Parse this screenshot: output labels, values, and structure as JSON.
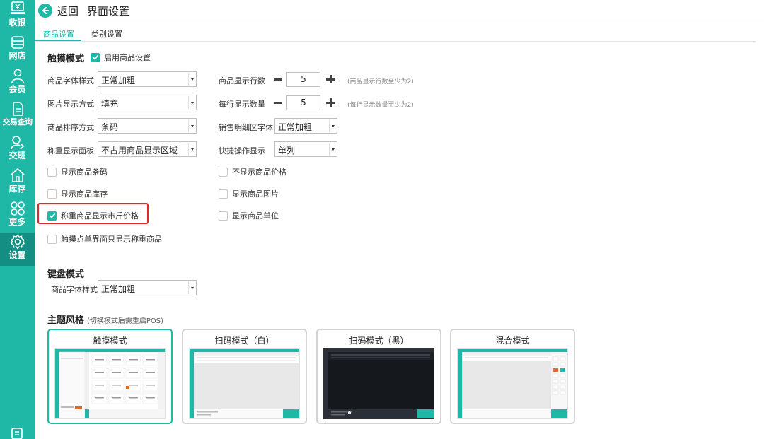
{
  "sidebar": {
    "items": [
      {
        "label": "收银",
        "icon": "cashier-icon",
        "active": false
      },
      {
        "label": "网店",
        "icon": "store-icon",
        "active": false
      },
      {
        "label": "会员",
        "icon": "member-icon",
        "active": false
      },
      {
        "label": "交易查询",
        "icon": "document-icon",
        "active": false
      },
      {
        "label": "交班",
        "icon": "handover-icon",
        "active": false
      },
      {
        "label": "库存",
        "icon": "home-icon",
        "active": false
      },
      {
        "label": "更多",
        "icon": "more-grid-icon",
        "active": false
      },
      {
        "label": "设置",
        "icon": "gear-icon",
        "active": true
      }
    ]
  },
  "header": {
    "back_label": "返回",
    "title": "界面设置"
  },
  "tabs": [
    {
      "label": "商品设置",
      "active": true
    },
    {
      "label": "类别设置",
      "active": false
    }
  ],
  "touch": {
    "section_title": "触摸模式",
    "enable_label": "启用商品设置",
    "enable_checked": true,
    "font_style_label": "商品字体样式",
    "font_style_value": "正常加粗",
    "image_mode_label": "图片显示方式",
    "image_mode_value": "填充",
    "sort_label": "商品排序方式",
    "sort_value": "条码",
    "scale_panel_label": "称重显示面板",
    "scale_panel_value": "不占用商品显示区域",
    "rows_label": "商品显示行数",
    "rows_value": "5",
    "rows_hint": "(商品显示行数至少为2)",
    "per_row_label": "每行显示数量",
    "per_row_value": "5",
    "per_row_hint": "(每行显示数量至少为2)",
    "detail_font_label": "销售明细区字体",
    "detail_font_value": "正常加粗",
    "quick_op_label": "快捷操作显示",
    "quick_op_value": "单列",
    "checks_left": [
      {
        "label": "显示商品条码",
        "checked": false
      },
      {
        "label": "显示商品库存",
        "checked": false
      },
      {
        "label": "称重商品显示市斤价格",
        "checked": true
      },
      {
        "label": "触摸点单界面只显示称重商品",
        "checked": false
      }
    ],
    "checks_right": [
      {
        "label": "不显示商品价格",
        "checked": false
      },
      {
        "label": "显示商品图片",
        "checked": false
      },
      {
        "label": "显示商品单位",
        "checked": false
      }
    ]
  },
  "keyboard": {
    "section_title": "键盘模式",
    "font_style_label": "商品字体样式",
    "font_style_value": "正常加粗"
  },
  "theme": {
    "section_title": "主题风格",
    "hint": "(切换模式后需重启POS)",
    "cards": [
      {
        "label": "触摸模式",
        "selected": true
      },
      {
        "label": "扫码模式（白）",
        "selected": false
      },
      {
        "label": "扫码模式（黑）",
        "selected": false
      },
      {
        "label": "混合模式",
        "selected": false
      }
    ]
  },
  "colors": {
    "accent": "#1fb7a6",
    "sidebar_active": "#148e82",
    "highlight": "#e02a2a"
  }
}
